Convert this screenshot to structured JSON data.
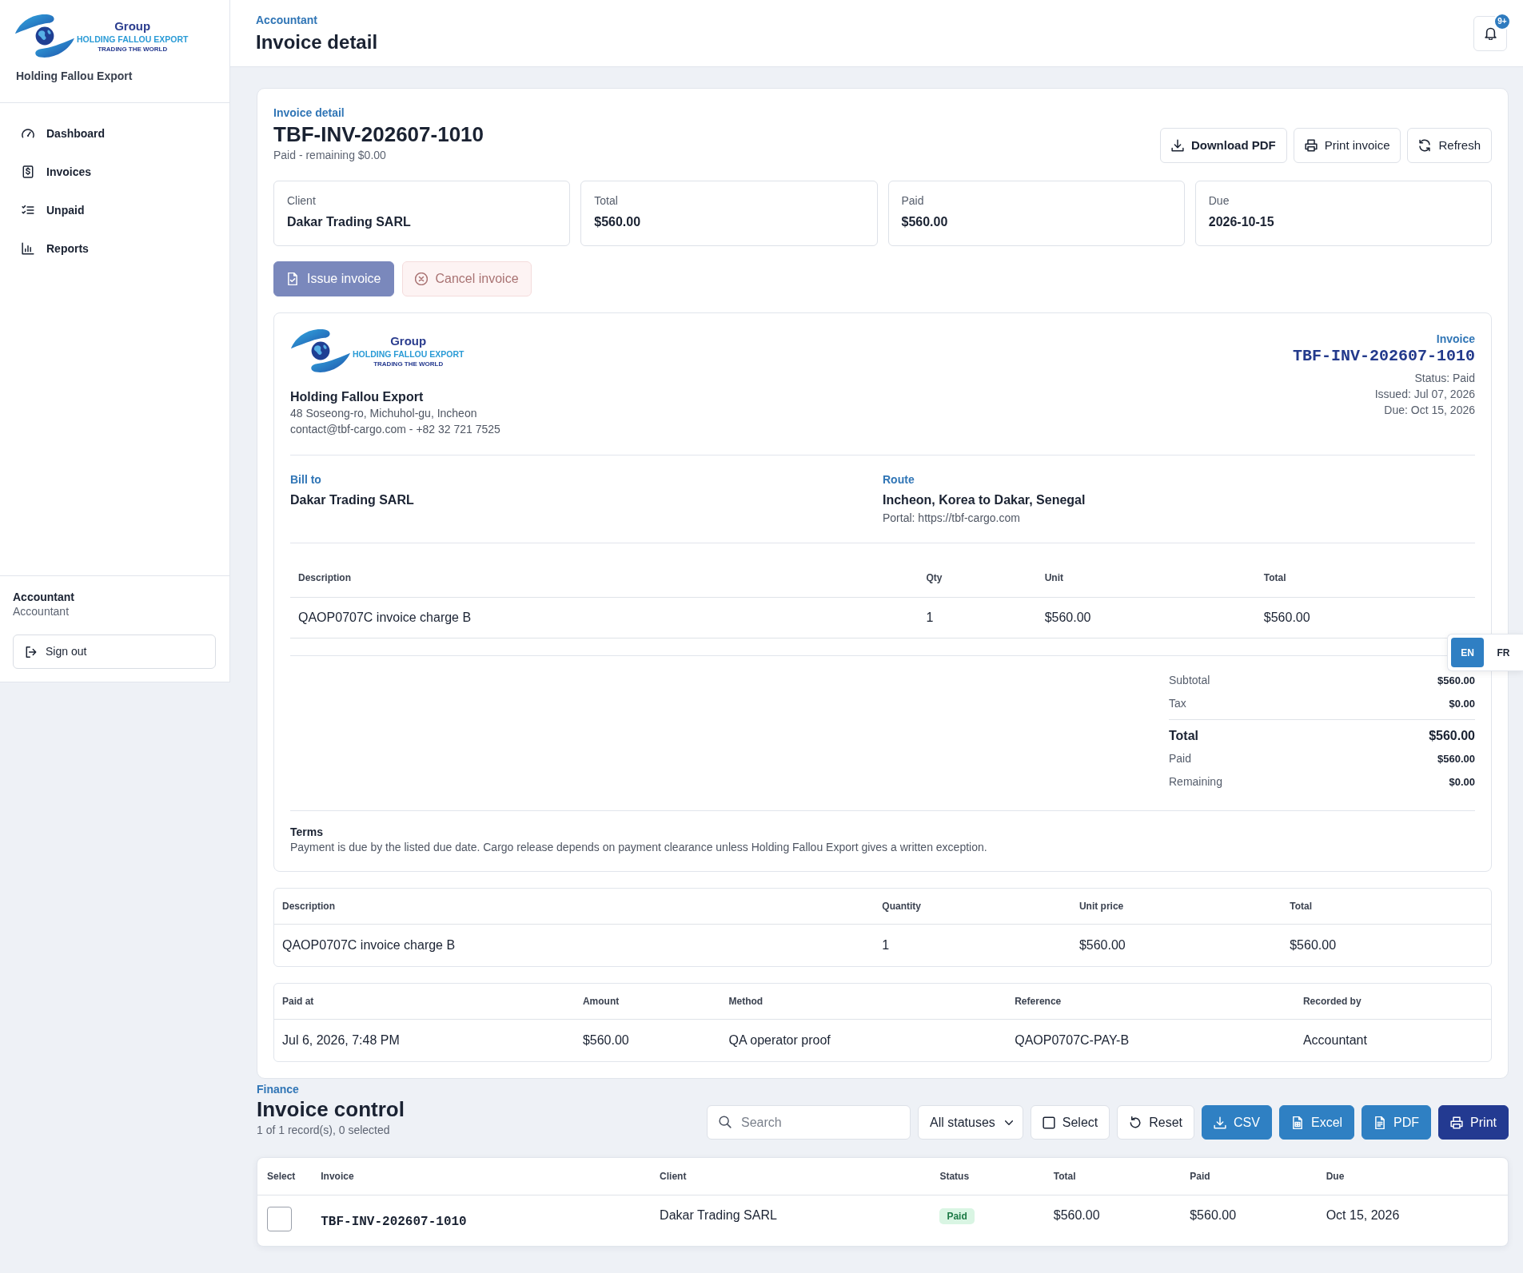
{
  "sidebar": {
    "logo": {
      "group": "Group",
      "name": "HOLDING FALLOU EXPORT",
      "tagline": "TRADING THE WORLD"
    },
    "company": "Holding Fallou Export",
    "items": [
      {
        "label": "Dashboard"
      },
      {
        "label": "Invoices"
      },
      {
        "label": "Unpaid"
      },
      {
        "label": "Reports"
      }
    ],
    "user": {
      "name": "Accountant",
      "role": "Accountant"
    },
    "sign_out": "Sign out"
  },
  "header": {
    "eyebrow": "Accountant",
    "title": "Invoice detail",
    "notification_count": "9+"
  },
  "detail": {
    "eyebrow": "Invoice detail",
    "title": "TBF-INV-202607-1010",
    "subtitle": "Paid - remaining $0.00",
    "actions": [
      {
        "label": "Download PDF",
        "kind": "strong"
      },
      {
        "label": "Print invoice",
        "kind": "plain"
      },
      {
        "label": "Refresh",
        "kind": "plain"
      }
    ],
    "stats": [
      {
        "label": "Client",
        "value": "Dakar Trading SARL"
      },
      {
        "label": "Total",
        "value": "$560.00"
      },
      {
        "label": "Paid",
        "value": "$560.00"
      },
      {
        "label": "Due",
        "value": "2026-10-15"
      }
    ],
    "buttons": [
      {
        "label": "Issue invoice",
        "kind": "primary",
        "disabled": true
      },
      {
        "label": "Cancel invoice",
        "kind": "danger",
        "disabled": true
      }
    ]
  },
  "document": {
    "logo": {
      "group": "Group",
      "name": "HOLDING FALLOU EXPORT",
      "tagline": "TRADING THE WORLD"
    },
    "company": "Holding Fallou Export",
    "address": "48 Soseong-ro, Michuhol-gu, Incheon",
    "contact": "contact@tbf-cargo.com - +82 32 721 7525",
    "type_label": "Invoice",
    "number": "TBF-INV-202607-1010",
    "meta": [
      "Status: Paid",
      "Issued: Jul 07, 2026",
      "Due: Oct 15, 2026"
    ],
    "bill_to": {
      "label": "Bill to",
      "name": "Dakar Trading SARL"
    },
    "route": {
      "label": "Route",
      "text": "Incheon, Korea to Dakar, Senegal",
      "portal": "Portal: https://tbf-cargo.com"
    },
    "table": {
      "columns": [
        "Description",
        "Qty",
        "Unit",
        "Total"
      ],
      "rows": [
        [
          "QAOP0707C invoice charge B",
          "1",
          "$560.00",
          "$560.00"
        ]
      ]
    },
    "totals": [
      {
        "label": "Subtotal",
        "value": "$560.00",
        "kind": "line"
      },
      {
        "label": "Tax",
        "value": "$0.00",
        "kind": "line"
      },
      {
        "label": "Total",
        "value": "$560.00",
        "kind": "grand"
      },
      {
        "label": "Paid",
        "value": "$560.00",
        "kind": "line"
      },
      {
        "label": "Remaining",
        "value": "$0.00",
        "kind": "line"
      }
    ],
    "terms": {
      "title": "Terms",
      "text": "Payment is due by the listed due date. Cargo release depends on payment clearance unless Holding Fallou Export gives a written exception."
    }
  },
  "items_table": {
    "columns": [
      "Description",
      "Quantity",
      "Unit price",
      "Total"
    ],
    "rows": [
      [
        "QAOP0707C invoice charge B",
        "1",
        "$560.00",
        "$560.00"
      ]
    ]
  },
  "payments_table": {
    "columns": [
      "Paid at",
      "Amount",
      "Method",
      "Reference",
      "Recorded by"
    ],
    "rows": [
      [
        "Jul 6, 2026, 7:48 PM",
        "$560.00",
        "QA operator proof",
        "QAOP0707C-PAY-B",
        "Accountant"
      ]
    ]
  },
  "control": {
    "eyebrow": "Finance",
    "title": "Invoice control",
    "summary": "1 of 1 record(s), 0 selected",
    "search": {
      "placeholder": "Search"
    },
    "status_filter": "All statuses",
    "buttons": [
      {
        "label": "Select",
        "kind": "outline"
      },
      {
        "label": "Reset",
        "kind": "outline"
      },
      {
        "label": "CSV",
        "kind": "primary"
      },
      {
        "label": "Excel",
        "kind": "primary"
      },
      {
        "label": "PDF",
        "kind": "primary"
      },
      {
        "label": "Print",
        "kind": "dark"
      }
    ],
    "table": {
      "select_header": "Select",
      "columns": [
        {
          "label": "Invoice",
          "kind": "mono"
        },
        {
          "label": "Client",
          "kind": "text"
        },
        {
          "label": "Status",
          "kind": "badge"
        },
        {
          "label": "Total",
          "kind": "text"
        },
        {
          "label": "Paid",
          "kind": "text"
        },
        {
          "label": "Due",
          "kind": "text"
        }
      ],
      "rows": [
        {
          "checked": false,
          "cells": [
            "TBF-INV-202607-1010",
            "Dakar Trading SARL",
            "Paid",
            "$560.00",
            "$560.00",
            "Oct 15, 2026"
          ]
        }
      ]
    }
  },
  "language": [
    {
      "label": "EN",
      "selected": true
    },
    {
      "label": "FR",
      "selected": false
    }
  ]
}
